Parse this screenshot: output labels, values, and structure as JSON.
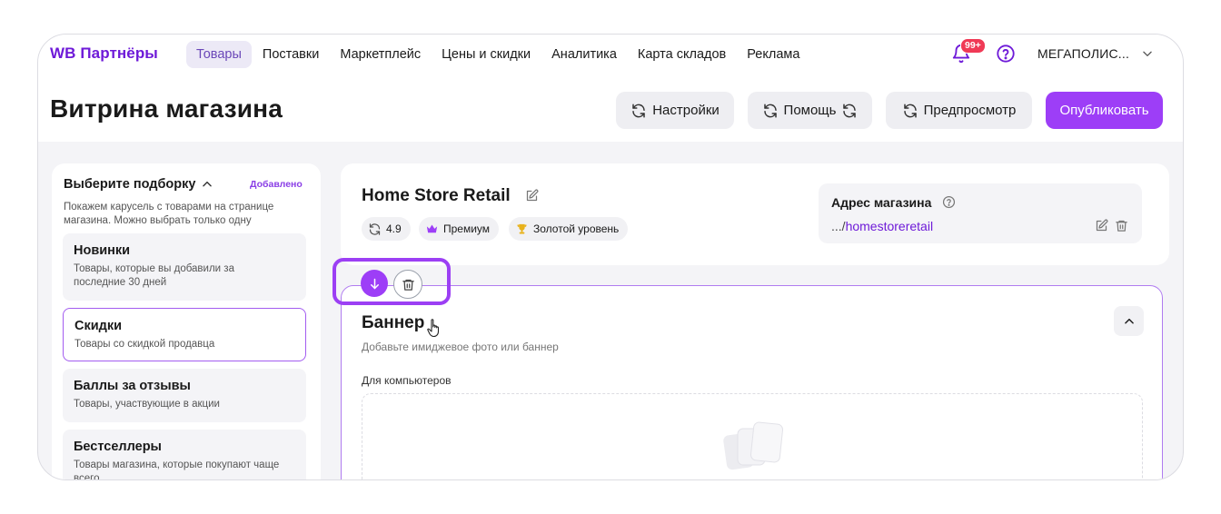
{
  "topbar": {
    "logo": "WB Партнёры",
    "nav": [
      "Товары",
      "Поставки",
      "Маркетплейс",
      "Цены и скидки",
      "Аналитика",
      "Карта складов",
      "Реклама"
    ],
    "active_nav": "Товары",
    "notifications_badge": "99+",
    "account_name": "МЕГАПОЛИС..."
  },
  "header": {
    "title": "Витрина магазина",
    "settings_label": "Настройки",
    "help_label": "Помощь",
    "preview_label": "Предпросмотр",
    "publish_label": "Опубликовать"
  },
  "collections": {
    "title": "Выберите подборку",
    "added_label": "Добавлено",
    "description": "Покажем карусель с товарами на странице магазина. Можно выбрать только одну",
    "items": [
      {
        "title": "Новинки",
        "desc": "Товары, которые вы добавили за последние 30 дней"
      },
      {
        "title": "Скидки",
        "desc": "Товары со скидкой продавца"
      },
      {
        "title": "Баллы за отзывы",
        "desc": "Товары, участвующие в акции"
      },
      {
        "title": "Бестселлеры",
        "desc": "Товары магазина, которые покупают чаще всего"
      }
    ],
    "selected_index": 1
  },
  "store": {
    "name": "Home Store Retail",
    "rating": "4.9",
    "premium_label": "Премиум",
    "level_label": "Золотой уровень",
    "address_title": "Адрес магазина",
    "address_prefix": ".../",
    "address_slug": "homestoreretail"
  },
  "banner": {
    "title": "Баннер",
    "subtitle": "Добавьте имиджевое фото или баннер",
    "desktop_label": "Для компьютеров"
  },
  "colors": {
    "brand": "#6e1ad8",
    "accent": "#9d3ef7",
    "highlight": "#9c3ff4"
  }
}
